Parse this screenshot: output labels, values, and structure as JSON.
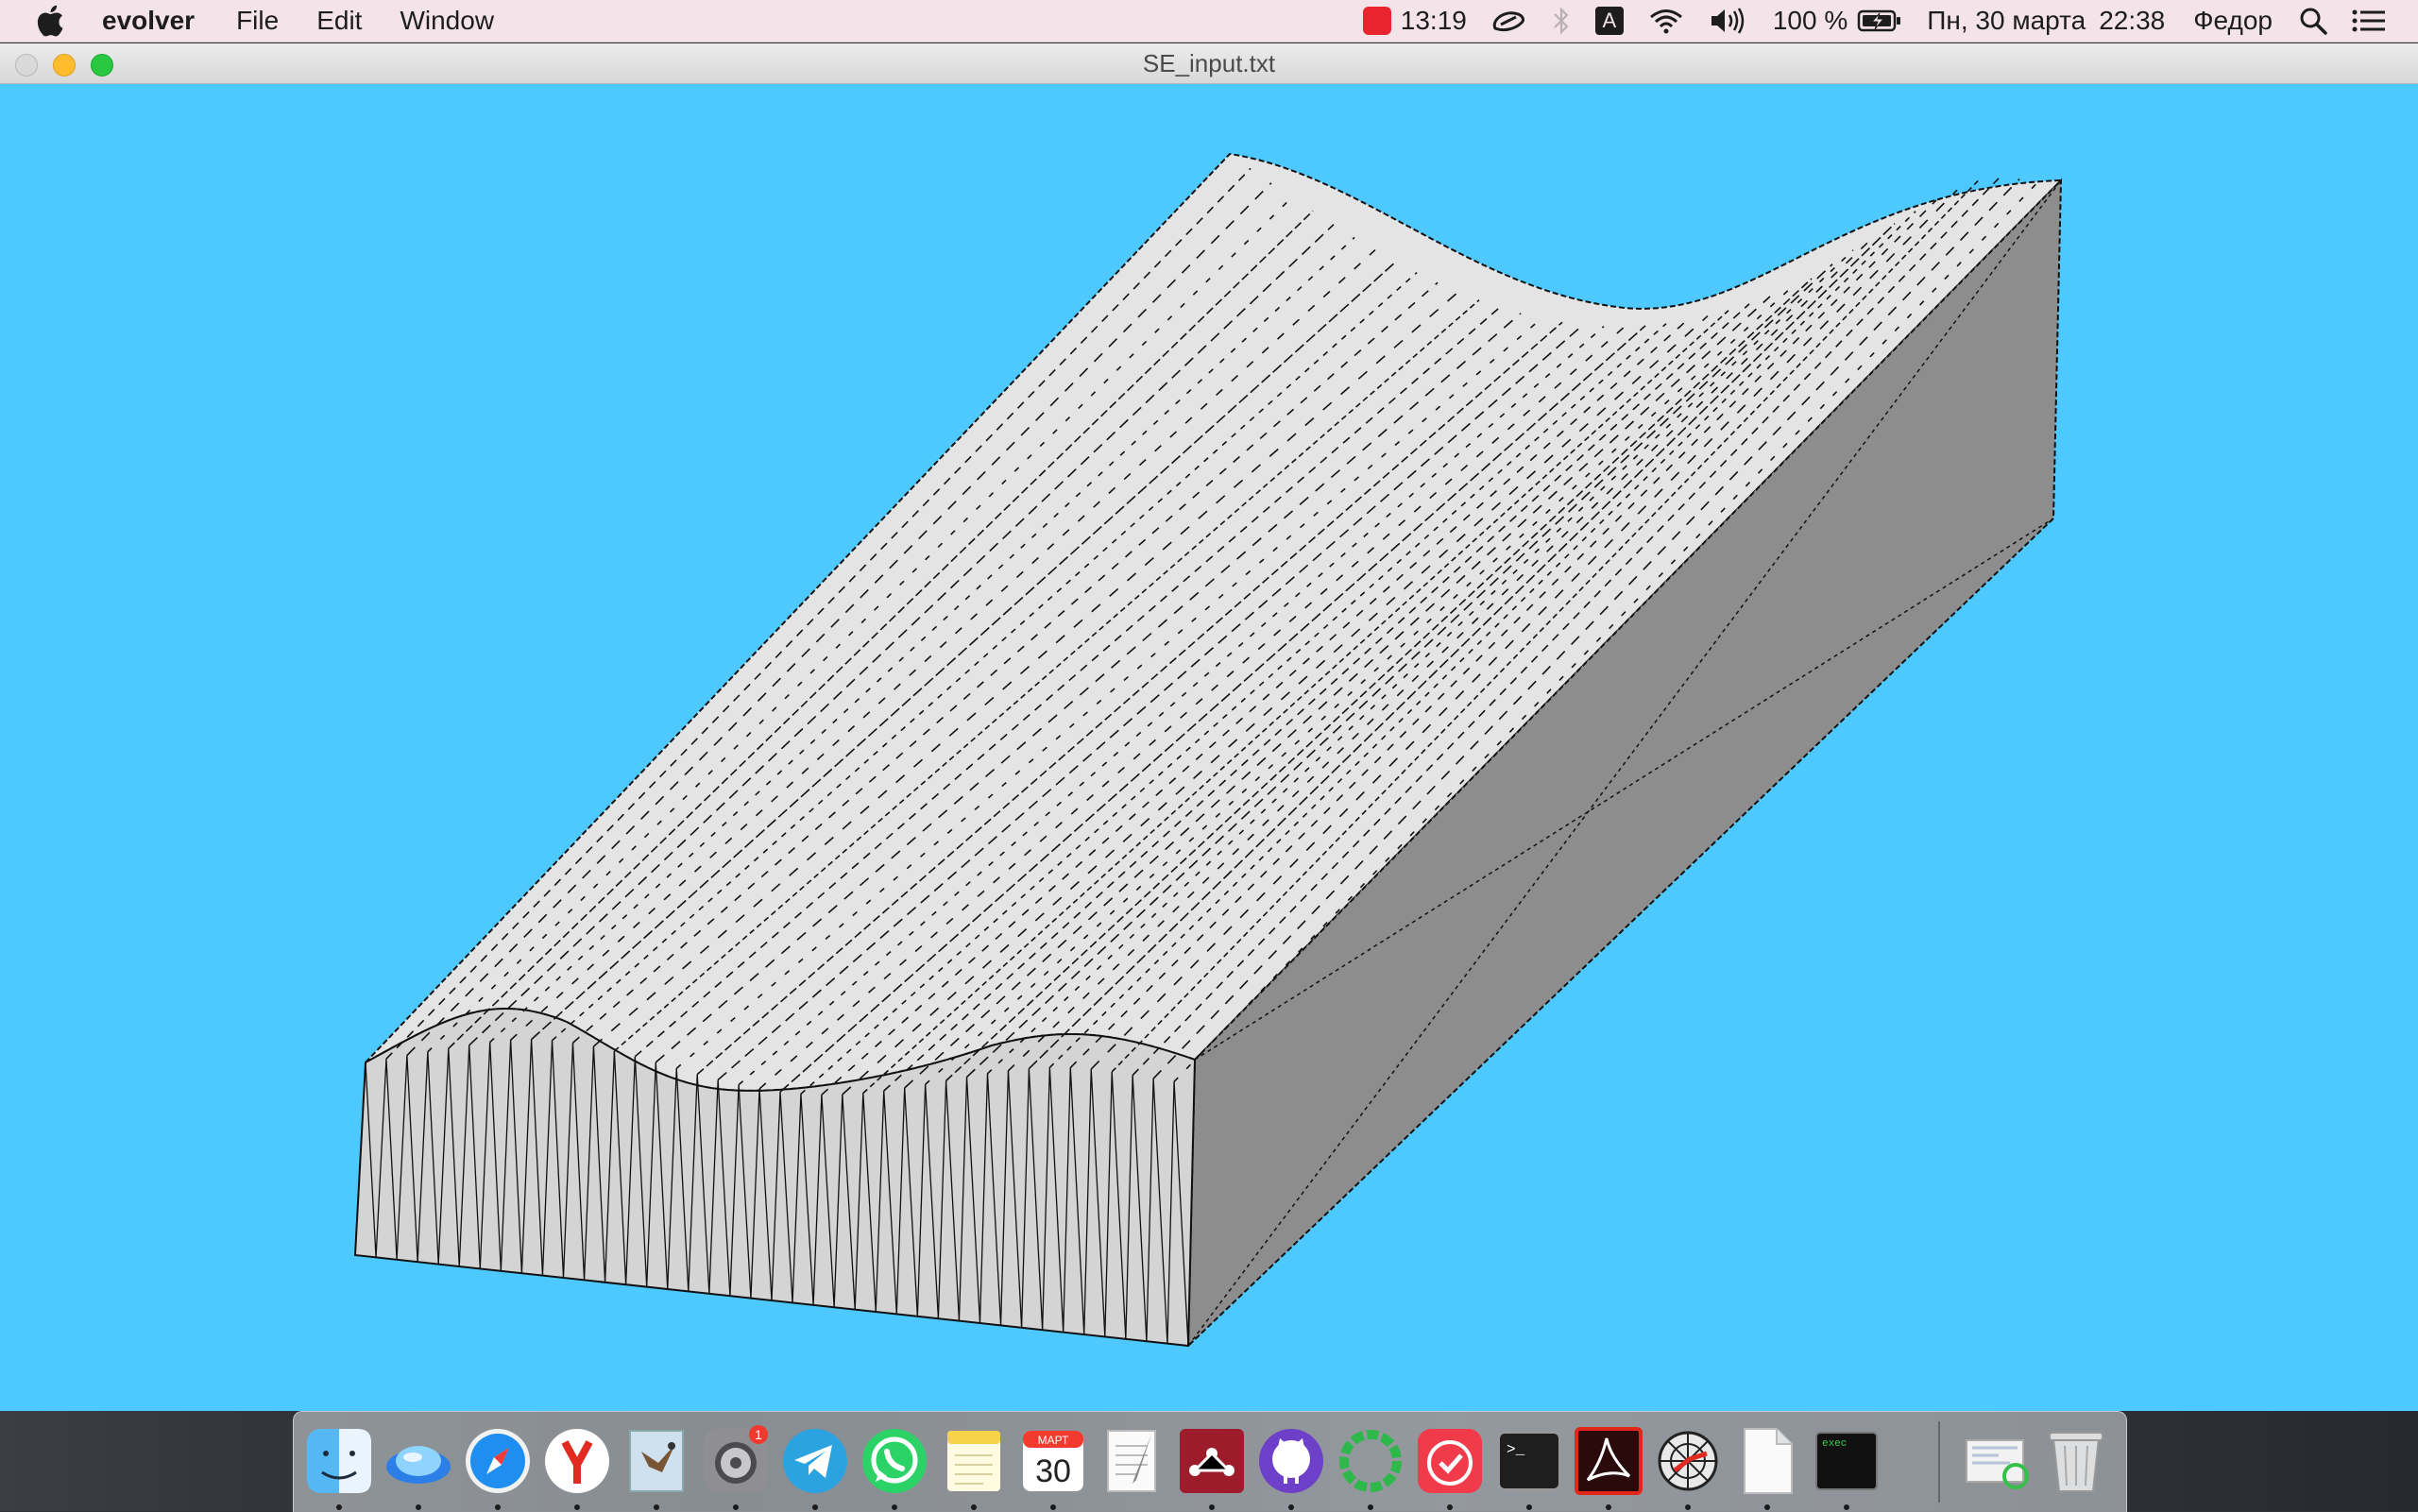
{
  "menubar": {
    "app_name": "evolver",
    "items": [
      "File",
      "Edit",
      "Window"
    ],
    "status": {
      "clock_widget_time": "13:19",
      "battery_percent": "100 %",
      "date": "Пн, 30 марта",
      "time": "22:38",
      "user": "Федор",
      "input_letter": "A"
    }
  },
  "window": {
    "title": "SE_input.txt",
    "background_color": "#4dc9ff"
  },
  "dock": {
    "items": [
      {
        "name": "finder",
        "running": true
      },
      {
        "name": "yandex-disk",
        "running": true
      },
      {
        "name": "safari",
        "running": true
      },
      {
        "name": "yandex-browser",
        "running": true
      },
      {
        "name": "mail",
        "running": true
      },
      {
        "name": "system-preferences",
        "running": true,
        "badge": "1"
      },
      {
        "name": "telegram",
        "running": true
      },
      {
        "name": "whatsapp",
        "running": true
      },
      {
        "name": "notes",
        "running": true
      },
      {
        "name": "calendar",
        "running": true,
        "month": "МАРТ",
        "day": "30"
      },
      {
        "name": "textedit",
        "running": false
      },
      {
        "name": "mendeley",
        "running": true
      },
      {
        "name": "github-desktop",
        "running": true
      },
      {
        "name": "sync-app",
        "running": true
      },
      {
        "name": "clock-app",
        "running": true
      },
      {
        "name": "terminal",
        "running": true,
        "label": ">_"
      },
      {
        "name": "acrobat-reader",
        "running": true
      },
      {
        "name": "network-radar",
        "running": true
      },
      {
        "name": "document",
        "running": true
      },
      {
        "name": "exec-terminal",
        "running": true,
        "label": "exec"
      },
      {
        "name": "downloads-stack",
        "running": false
      },
      {
        "name": "trash",
        "running": false
      }
    ]
  }
}
